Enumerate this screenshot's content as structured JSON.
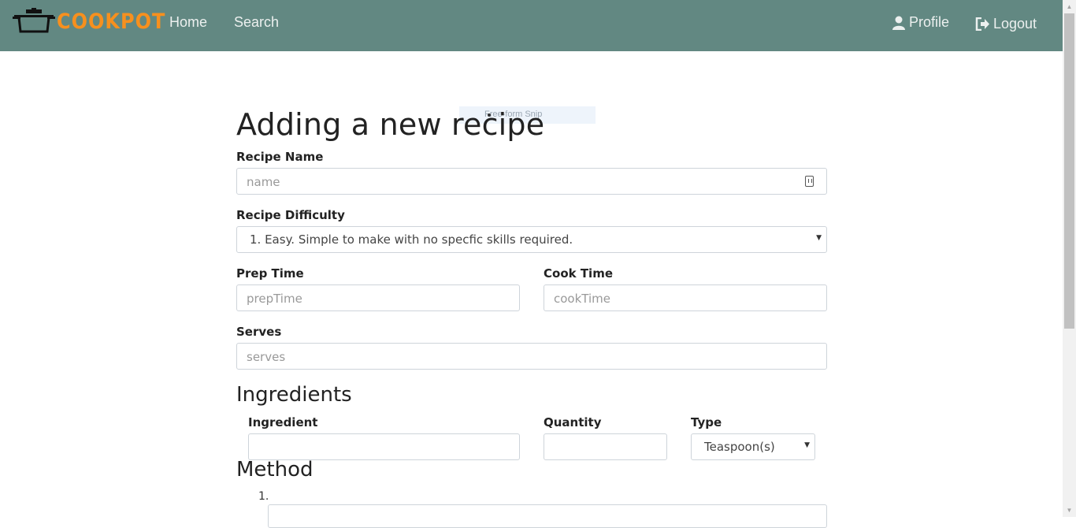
{
  "nav": {
    "logo_text": "COOKPOT",
    "home": "Home",
    "search": "Search",
    "profile": "Profile",
    "logout": "Logout"
  },
  "overlay": {
    "snip_label": "Free-form Snip"
  },
  "form": {
    "title": "Adding a new recipe",
    "recipe_name": {
      "label": "Recipe Name",
      "placeholder": "name"
    },
    "difficulty": {
      "label": "Recipe Difficulty",
      "selected": "1. Easy. Simple to make with no specfic skills required."
    },
    "prep_time": {
      "label": "Prep Time",
      "placeholder": "prepTime"
    },
    "cook_time": {
      "label": "Cook Time",
      "placeholder": "cookTime"
    },
    "serves": {
      "label": "Serves",
      "placeholder": "serves"
    },
    "ingredients": {
      "heading": "Ingredients",
      "ingredient_label": "Ingredient",
      "quantity_label": "Quantity",
      "type_label": "Type",
      "type_selected": "Teaspoon(s)"
    },
    "method": {
      "heading": "Method",
      "step_number": "1."
    }
  },
  "colors": {
    "navbar": "#628882",
    "logo": "#f7901e"
  }
}
